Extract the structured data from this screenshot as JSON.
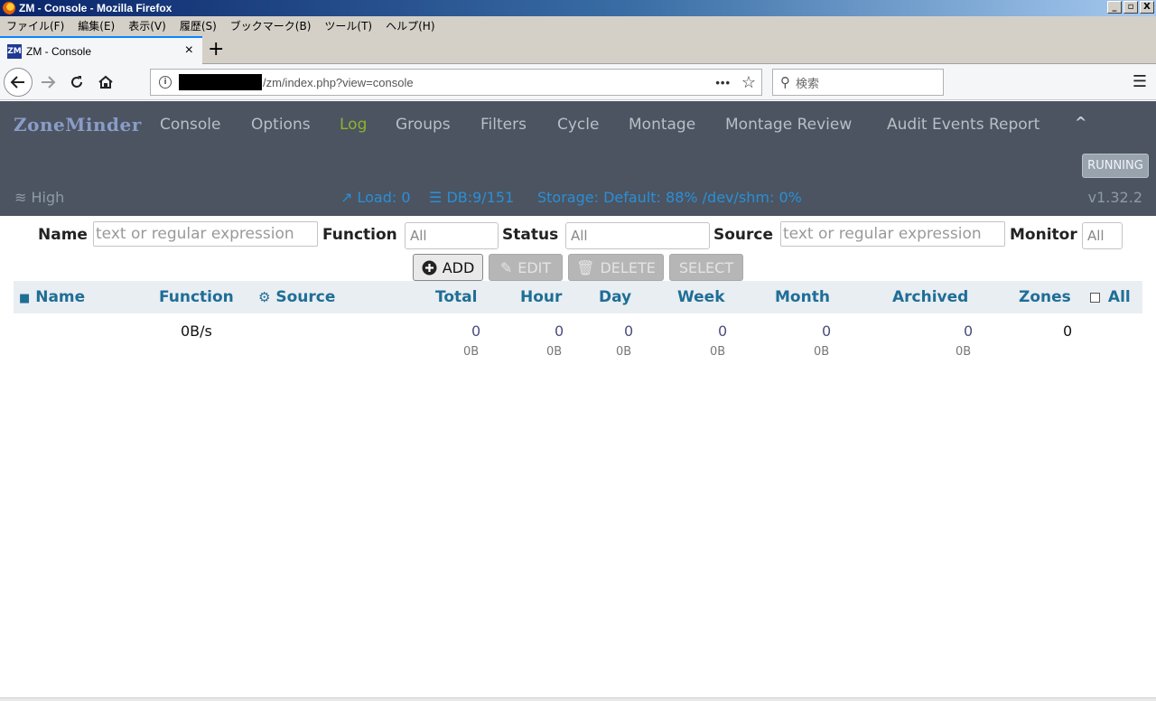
{
  "window": {
    "title": "ZM - Console - Mozilla Firefox",
    "controls": [
      "_",
      "▫",
      "X"
    ]
  },
  "menubar": [
    "ファイル(F)",
    "編集(E)",
    "表示(V)",
    "履歴(S)",
    "ブックマーク(B)",
    "ツール(T)",
    "ヘルプ(H)"
  ],
  "tab": {
    "favicon": "ZM",
    "title": "ZM - Console",
    "close": "×",
    "new": "+"
  },
  "nav": {
    "url": "/zm/index.php?view=console",
    "search_placeholder": "検索",
    "page_actions": "•••"
  },
  "zm": {
    "brand": "ZoneMinder",
    "nav_items": [
      "Console",
      "Options",
      "Log",
      "Groups",
      "Filters",
      "Cycle",
      "Montage",
      "Montage Review",
      "Audit Events Report"
    ],
    "active_item": "Log",
    "status_button": "RUNNING",
    "bandwidth": "High",
    "load": "Load: 0",
    "db": "DB:9/151",
    "storage": "Storage: Default: 88% /dev/shm: 0%",
    "version": "v1.32.2"
  },
  "filters": {
    "name_label": "Name",
    "name_placeholder": "text or regular expression",
    "function_label": "Function",
    "function_value": "All",
    "status_label": "Status",
    "status_value": "All",
    "source_label": "Source",
    "source_placeholder": "text or regular expression",
    "monitor_label": "Monitor",
    "monitor_value": "All"
  },
  "actions": {
    "add": "ADD",
    "edit": "EDIT",
    "delete": "DELETE",
    "select": "SELECT"
  },
  "table": {
    "headers": {
      "name": "Name",
      "function": "Function",
      "source": "Source",
      "total": "Total",
      "hour": "Hour",
      "day": "Day",
      "week": "Week",
      "month": "Month",
      "archived": "Archived",
      "zones": "Zones",
      "all": "All"
    },
    "footer": {
      "function": "0B/s",
      "total": "0",
      "total_size": "0B",
      "hour": "0",
      "hour_size": "0B",
      "day": "0",
      "day_size": "0B",
      "week": "0",
      "week_size": "0B",
      "month": "0",
      "month_size": "0B",
      "archived": "0",
      "archived_size": "0B",
      "zones": "0"
    }
  }
}
